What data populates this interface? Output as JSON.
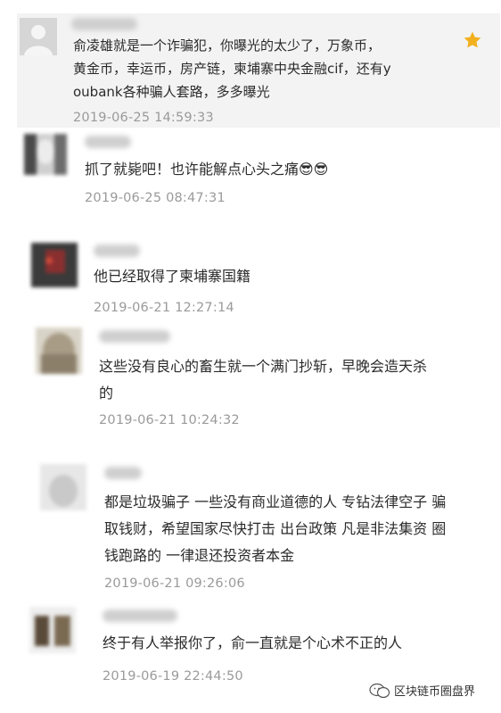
{
  "comments": [
    {
      "text_lines": [
        "俞凌雄就是一个诈骗犯，你曝光的太少了，万象币，",
        "黄金币，幸运币，房产链，柬埔寨中央金融cif，还有y",
        "oubank各种骗人套路，多多曝光"
      ],
      "time": "2019-06-25 14:59:33"
    },
    {
      "text_lines": [
        "抓了就毙吧！也许能解点心头之痛😎😎"
      ],
      "time": "2019-06-25 08:47:31"
    },
    {
      "text_lines": [
        "他已经取得了柬埔寨国籍"
      ],
      "time": "2019-06-21 12:27:14"
    },
    {
      "text_lines": [
        "这些没有良心的畜生就一个满门抄斩，早晚会造天杀",
        "的"
      ],
      "time": "2019-06-21 10:24:32"
    },
    {
      "text_lines": [
        "都是垃圾骗子 一些没有商业道德的人 专钻法律空子 骗",
        "取钱财，希望国家尽快打击 出台政策 凡是非法集资 圈",
        "钱跑路的 一律退还投资者本金"
      ],
      "time": "2019-06-21 09:26:06"
    },
    {
      "text_lines": [
        "终于有人举报你了，俞一直就是个心术不正的人"
      ],
      "time": "2019-06-19 22:44:50"
    }
  ],
  "footer": {
    "label": "区块链币圈盘界",
    "icon": "wechat-icon"
  },
  "colors": {
    "pinned_bg": "#f3f3f3",
    "star": "#f2b01e",
    "time": "#9a9a9a"
  }
}
